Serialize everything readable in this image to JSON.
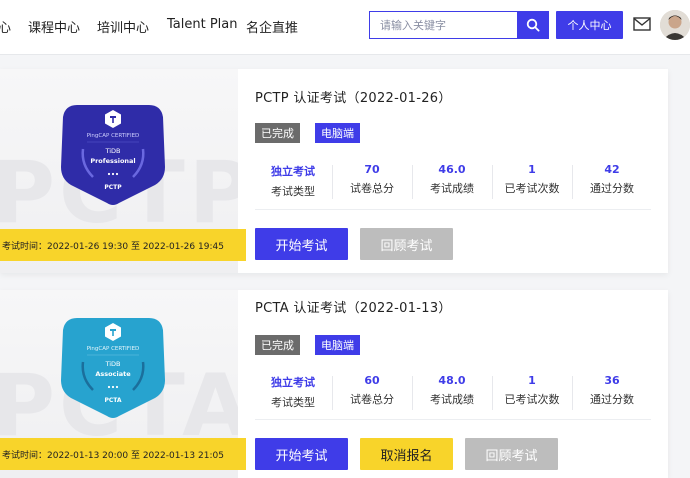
{
  "nav": {
    "items": [
      "心",
      "课程中心",
      "培训中心",
      "Talent Plan",
      "名企直推"
    ],
    "search_placeholder": "请输入关键字",
    "personal_center": "个人中心"
  },
  "colors": {
    "accent": "#3f3ce8",
    "yellow": "#f8d42a",
    "done_gray": "#6b6b6b",
    "disabled_gray": "#bdbdbd"
  },
  "exams": [
    {
      "title": "PCTP 认证考试（2022-01-26）",
      "status": "已完成",
      "platform": "电脑端",
      "watermark": "PCTP",
      "badge": {
        "org": "PingCAP CERTIFIED",
        "line1": "TiDB",
        "line2": "Professional",
        "code": "PCTP",
        "color": "#2f2ca8"
      },
      "stats": [
        {
          "value": "独立考试",
          "label": "考试类型"
        },
        {
          "value": "70",
          "label": "试卷总分"
        },
        {
          "value": "46.0",
          "label": "考试成绩"
        },
        {
          "value": "1",
          "label": "已考试次数"
        },
        {
          "value": "42",
          "label": "通过分数"
        }
      ],
      "time": "考试时间：2022-01-26 19:30 至 2022-01-26 19:45",
      "buttons": [
        "开始考试",
        "回顾考试"
      ]
    },
    {
      "title": "PCTA 认证考试（2022-01-13）",
      "status": "已完成",
      "platform": "电脑端",
      "watermark": "PCTA",
      "badge": {
        "org": "PingCAP CERTIFIED",
        "line1": "TiDB",
        "line2": "Associate",
        "code": "PCTA",
        "color": "#27a3cf"
      },
      "stats": [
        {
          "value": "独立考试",
          "label": "考试类型"
        },
        {
          "value": "60",
          "label": "试卷总分"
        },
        {
          "value": "48.0",
          "label": "考试成绩"
        },
        {
          "value": "1",
          "label": "已考试次数"
        },
        {
          "value": "36",
          "label": "通过分数"
        }
      ],
      "time": "考试时间：2022-01-13 20:00 至 2022-01-13 21:05",
      "buttons": [
        "开始考试",
        "取消报名",
        "回顾考试"
      ]
    }
  ]
}
